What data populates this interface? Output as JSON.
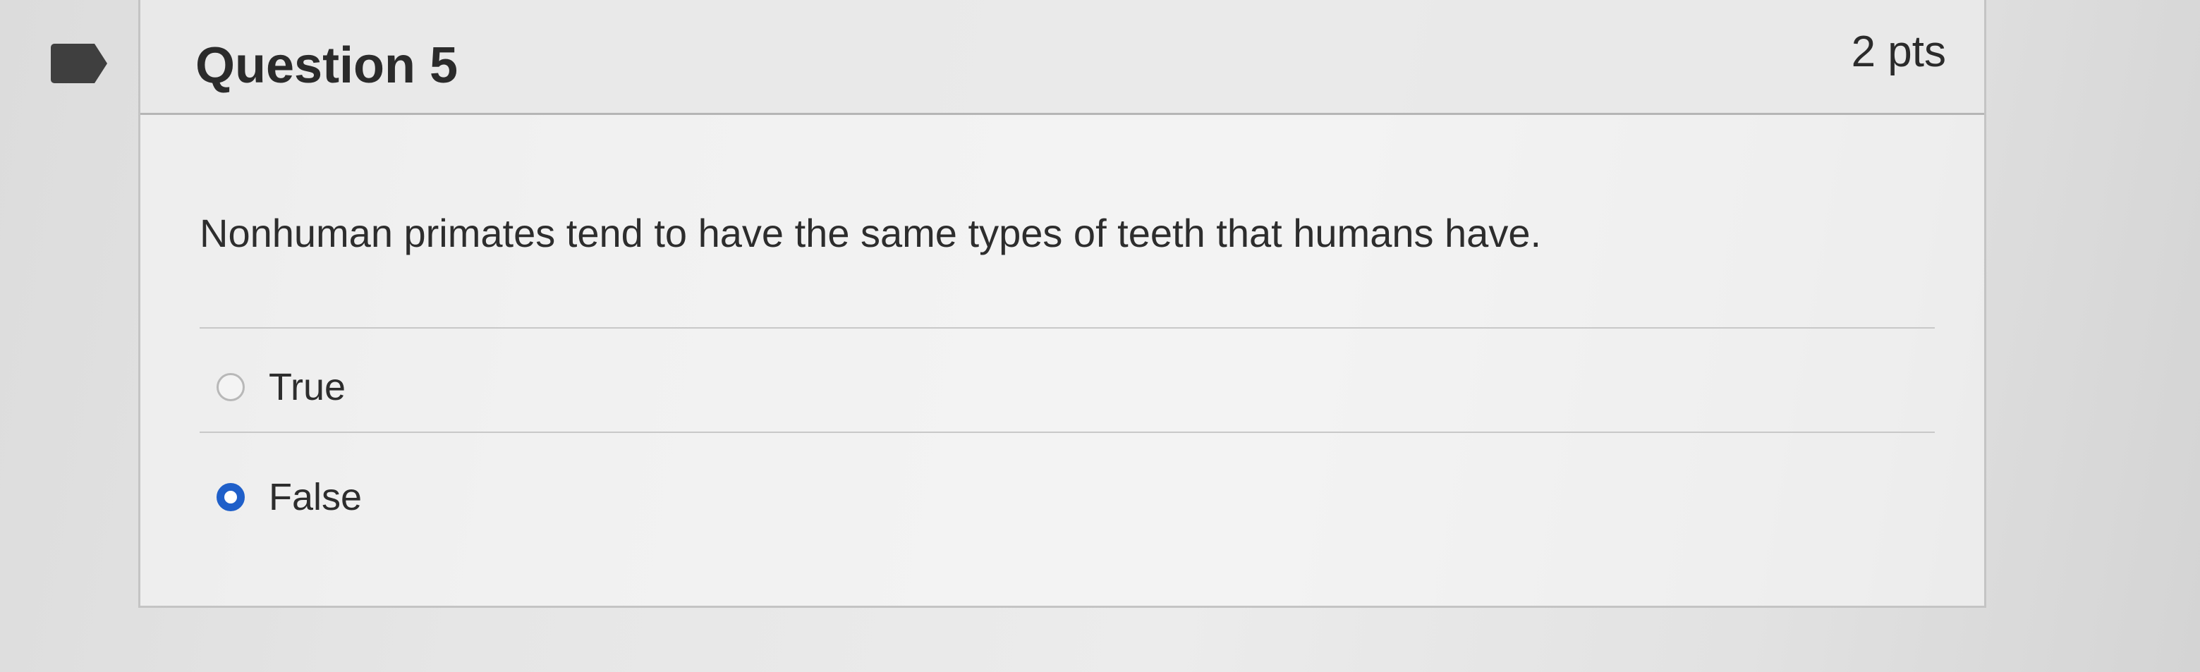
{
  "question": {
    "title": "Question 5",
    "points": "2 pts",
    "text": "Nonhuman primates tend to have the same types of teeth that humans have."
  },
  "answers": [
    {
      "label": "True",
      "selected": false
    },
    {
      "label": "False",
      "selected": true
    }
  ],
  "colors": {
    "selected_radio": "#1f5fc9",
    "flag": "#3f3f3f"
  }
}
